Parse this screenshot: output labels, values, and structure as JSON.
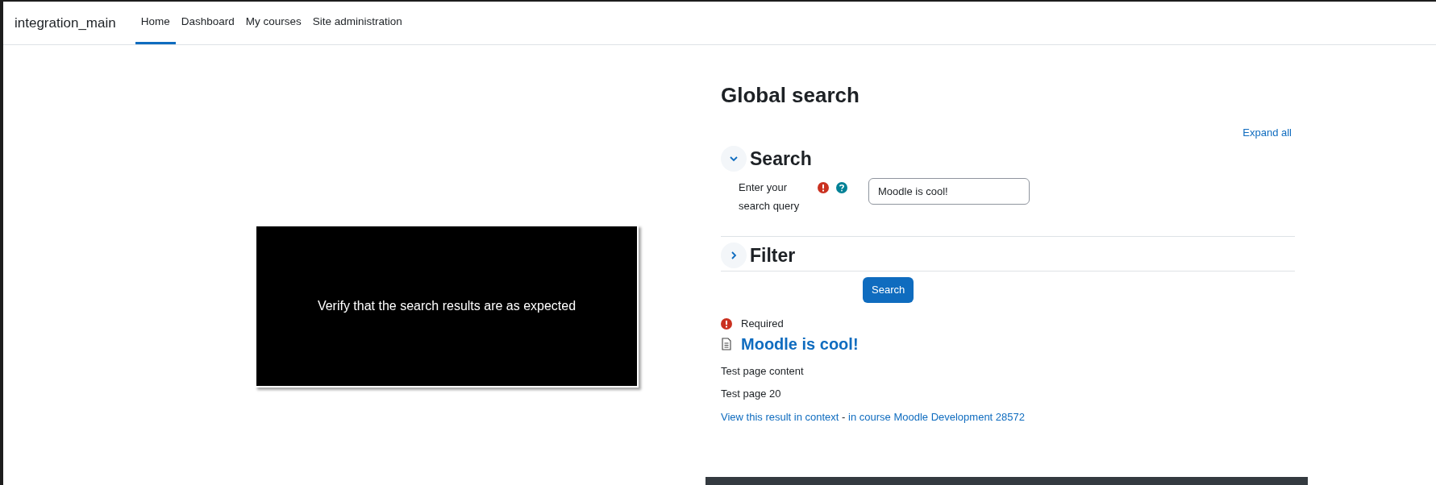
{
  "navbar": {
    "site_name": "integration_main",
    "tabs": [
      {
        "label": "Home",
        "selected": true
      },
      {
        "label": "Dashboard",
        "selected": false
      },
      {
        "label": "My courses",
        "selected": false
      },
      {
        "label": "Site administration",
        "selected": false
      }
    ]
  },
  "instruction_overlay": {
    "text": "Verify that the search results are as expected"
  },
  "page": {
    "title": "Global search",
    "expand_all": "Expand all",
    "sections": [
      {
        "title": "Search",
        "expanded": true,
        "field": {
          "label": "Enter your search query",
          "value": "Moodle is cool!"
        }
      },
      {
        "title": "Filter",
        "expanded": false
      }
    ],
    "submit": "Search",
    "required_note": "Required",
    "results": [
      {
        "title": "Moodle is cool!",
        "lines": [
          "Test page content",
          "Test page 20"
        ],
        "context_link": "View this result in context",
        "separator": " - ",
        "course_link": "in course Moodle Development 28572"
      }
    ]
  }
}
